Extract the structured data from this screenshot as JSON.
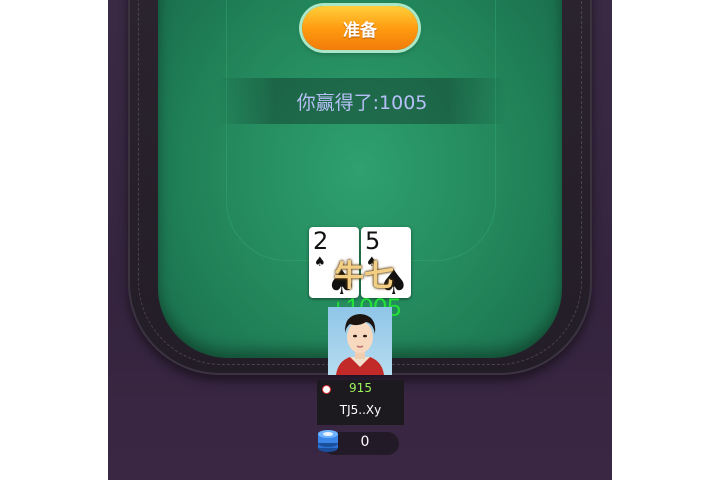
{
  "controls": {
    "ready_label": "准备"
  },
  "result": {
    "text": "你赢得了:1005"
  },
  "hand": {
    "cards": [
      {
        "rank": "2",
        "suit": "spades"
      },
      {
        "rank": "5",
        "suit": "spades"
      }
    ],
    "label": "牛七",
    "win_amount": "+1005"
  },
  "player": {
    "score": "915",
    "name": "TJ5..Xy",
    "bet": "0"
  },
  "icons": {
    "coin": "coin-icon",
    "chip": "chip-stack-icon",
    "avatar": "player-avatar"
  },
  "colors": {
    "felt": "#248a5d",
    "button": "#ff9c12",
    "result_text": "#b6bff7",
    "win_text": "#22e23a",
    "score_text": "#9df45a"
  }
}
